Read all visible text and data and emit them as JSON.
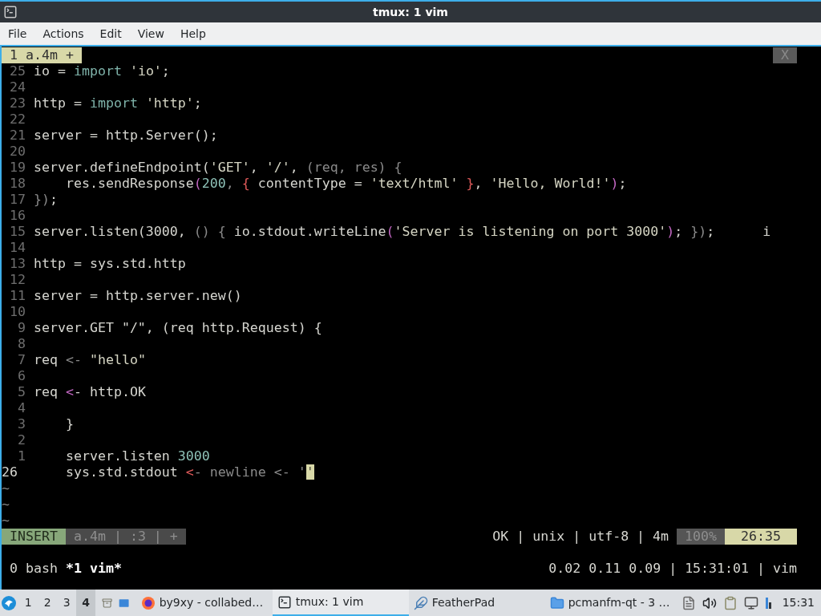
{
  "window": {
    "title": "tmux: 1 vim"
  },
  "menu": [
    "File",
    "Actions",
    "Edit",
    "View",
    "Help"
  ],
  "vim": {
    "tabline": {
      "tabs": [
        {
          "label": "1 a.4m +",
          "selected": true
        }
      ],
      "close": "X"
    },
    "lines": [
      {
        "number": "25",
        "current": false,
        "tokens": [
          {
            "text": "io = ",
            "kind": "plain"
          },
          {
            "text": "import",
            "kind": "keyword"
          },
          {
            "text": " 'io'",
            "kind": "string"
          },
          {
            "text": ";",
            "kind": "plain"
          }
        ]
      },
      {
        "number": "24",
        "current": false
      },
      {
        "number": "23",
        "current": false,
        "tokens": [
          {
            "text": "http = ",
            "kind": "plain"
          },
          {
            "text": "import",
            "kind": "keyword"
          },
          {
            "text": " 'http'",
            "kind": "string"
          },
          {
            "text": ";",
            "kind": "plain"
          }
        ]
      },
      {
        "number": "22",
        "current": false
      },
      {
        "number": "21",
        "current": false,
        "tokens": [
          {
            "text": "server = http.Server();",
            "kind": "plain"
          }
        ]
      },
      {
        "number": "20",
        "current": false
      },
      {
        "number": "19",
        "current": false,
        "tokens": [
          {
            "text": "server.defineEndpoint(",
            "kind": "plain"
          },
          {
            "text": "'GET'",
            "kind": "string"
          },
          {
            "text": ", ",
            "kind": "plain"
          },
          {
            "text": "'/'",
            "kind": "string"
          },
          {
            "text": ", ",
            "kind": "plain"
          },
          {
            "text": "(req, res) {",
            "kind": "dim"
          }
        ]
      },
      {
        "number": "18",
        "current": false,
        "tokens": [
          {
            "text": "    res.sendResponse",
            "kind": "plain"
          },
          {
            "text": "(",
            "kind": "accent"
          },
          {
            "text": "200",
            "kind": "number"
          },
          {
            "text": ", ",
            "kind": "dim"
          },
          {
            "text": "{",
            "kind": "red"
          },
          {
            "text": " contentType = ",
            "kind": "plain"
          },
          {
            "text": "'text/html' ",
            "kind": "string"
          },
          {
            "text": "}",
            "kind": "red"
          },
          {
            "text": ", ",
            "kind": "plain"
          },
          {
            "text": "'Hello, World!'",
            "kind": "string"
          },
          {
            "text": ")",
            "kind": "accent"
          },
          {
            "text": ";",
            "kind": "plain"
          }
        ]
      },
      {
        "number": "17",
        "current": false,
        "tokens": [
          {
            "text": "})",
            "kind": "dim"
          },
          {
            "text": ";",
            "kind": "plain"
          }
        ]
      },
      {
        "number": "16",
        "current": false
      },
      {
        "number": "15",
        "current": false,
        "tokens": [
          {
            "text": "server.listen(3000, ",
            "kind": "plain"
          },
          {
            "text": "() {",
            "kind": "dim"
          },
          {
            "text": " io.stdout.writeLine",
            "kind": "plain"
          },
          {
            "text": "(",
            "kind": "accent"
          },
          {
            "text": "'Server is listening on port 3000'",
            "kind": "string"
          },
          {
            "text": ")",
            "kind": "accent"
          },
          {
            "text": "; ",
            "kind": "plain"
          },
          {
            "text": "})",
            "kind": "dim"
          },
          {
            "text": ";      i",
            "kind": "plain"
          }
        ]
      },
      {
        "number": "14",
        "current": false
      },
      {
        "number": "13",
        "current": false,
        "tokens": [
          {
            "text": "http = sys.std.http",
            "kind": "plain"
          }
        ]
      },
      {
        "number": "12",
        "current": false
      },
      {
        "number": "11",
        "current": false,
        "tokens": [
          {
            "text": "server = http.server.new()",
            "kind": "plain"
          }
        ]
      },
      {
        "number": "10",
        "current": false
      },
      {
        "number": "9",
        "current": false,
        "tokens": [
          {
            "text": "server.GET \"/\", (req http.Request) {",
            "kind": "plain"
          }
        ]
      },
      {
        "number": "8",
        "current": false
      },
      {
        "number": "7",
        "current": false,
        "tokens": [
          {
            "text": "req ",
            "kind": "plain"
          },
          {
            "text": "<- ",
            "kind": "dim"
          },
          {
            "text": "\"hello\"",
            "kind": "string"
          }
        ]
      },
      {
        "number": "6",
        "current": false
      },
      {
        "number": "5",
        "current": false,
        "tokens": [
          {
            "text": "req ",
            "kind": "plain"
          },
          {
            "text": "<",
            "kind": "accent"
          },
          {
            "text": "- http.OK",
            "kind": "plain"
          }
        ]
      },
      {
        "number": "4",
        "current": false
      },
      {
        "number": "3",
        "current": false,
        "tokens": [
          {
            "text": "    }",
            "kind": "plain"
          }
        ]
      },
      {
        "number": "2",
        "current": false
      },
      {
        "number": "1",
        "current": false,
        "tokens": [
          {
            "text": "    server.listen ",
            "kind": "plain"
          },
          {
            "text": "3000",
            "kind": "number"
          }
        ]
      },
      {
        "number": "26",
        "current": true,
        "tokens": [
          {
            "text": "    sys.std.stdout ",
            "kind": "plain"
          },
          {
            "text": "<",
            "kind": "red"
          },
          {
            "text": "- newline <- '",
            "kind": "dim"
          },
          {
            "text": "'",
            "kind": "cursor"
          }
        ]
      }
    ],
    "filler_lines": [
      "~",
      "~",
      "~"
    ],
    "statusline": {
      "mode": "INSERT",
      "file": "a.4m | :3 | +",
      "info": "OK | unix | utf-8 | 4m",
      "percent": "100%",
      "position": "26:35"
    }
  },
  "tmux": {
    "windows": [
      {
        "label": "0 bash",
        "selected": false
      },
      {
        "label": "*1 vim*",
        "selected": true
      }
    ],
    "status_right": "0.02 0.11 0.09 | 15:31:01 | vim"
  },
  "taskbar": {
    "desktops": [
      {
        "label": "1",
        "selected": false
      },
      {
        "label": "2",
        "selected": false
      },
      {
        "label": "3",
        "selected": false
      },
      {
        "label": "4",
        "selected": true
      }
    ],
    "tasks": [
      {
        "label": "by9xy - collabed…",
        "kind": "browser",
        "selected": false
      },
      {
        "label": "tmux: 1 vim",
        "kind": "terminal",
        "selected": true
      },
      {
        "label": "FeatherPad",
        "kind": "editor",
        "selected": false
      },
      {
        "label": "pcmanfm-qt - 3 …",
        "kind": "folder",
        "selected": false
      }
    ],
    "clock": "15:31"
  }
}
